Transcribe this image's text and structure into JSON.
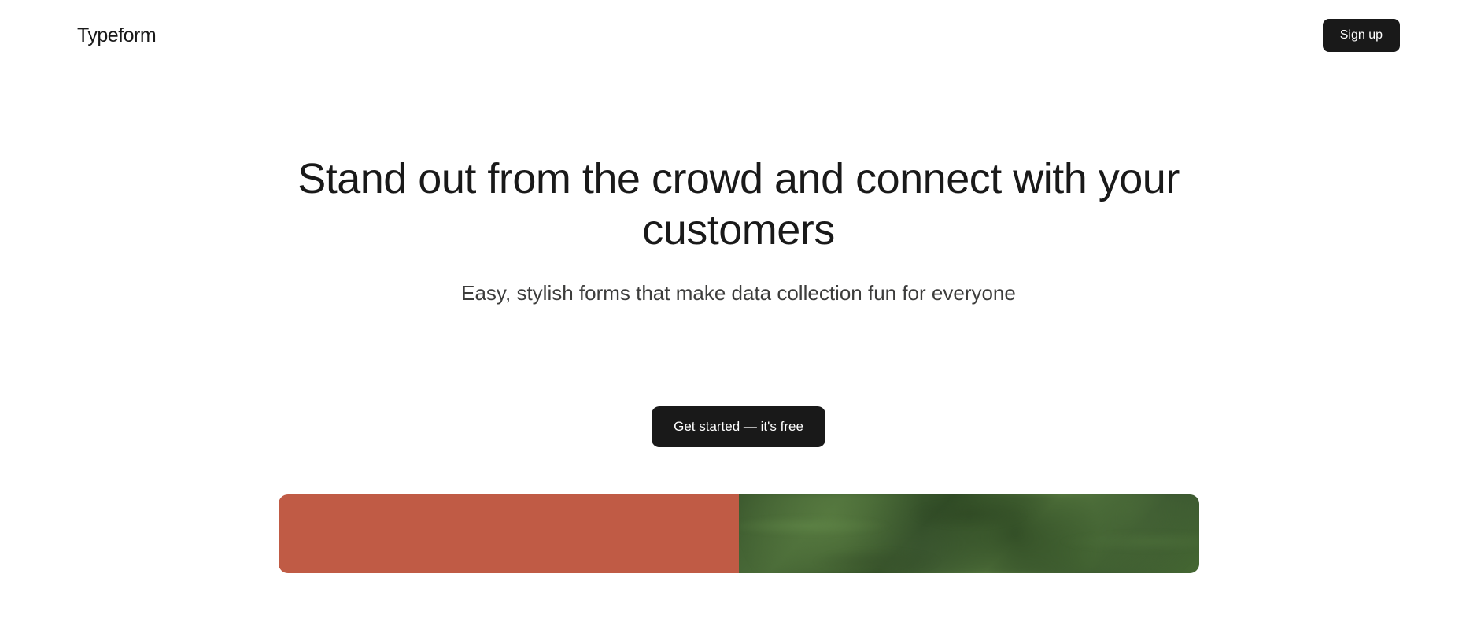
{
  "header": {
    "logo": "Typeform",
    "signup_label": "Sign up"
  },
  "hero": {
    "headline": "Stand out from the crowd and connect with your customers",
    "subheadline": "Easy, stylish forms that make data collection fun for everyone",
    "cta_label": "Get started — it's free"
  },
  "colors": {
    "primary": "#191919",
    "accent_left": "#c05b45",
    "text_secondary": "#3d3d3c"
  }
}
